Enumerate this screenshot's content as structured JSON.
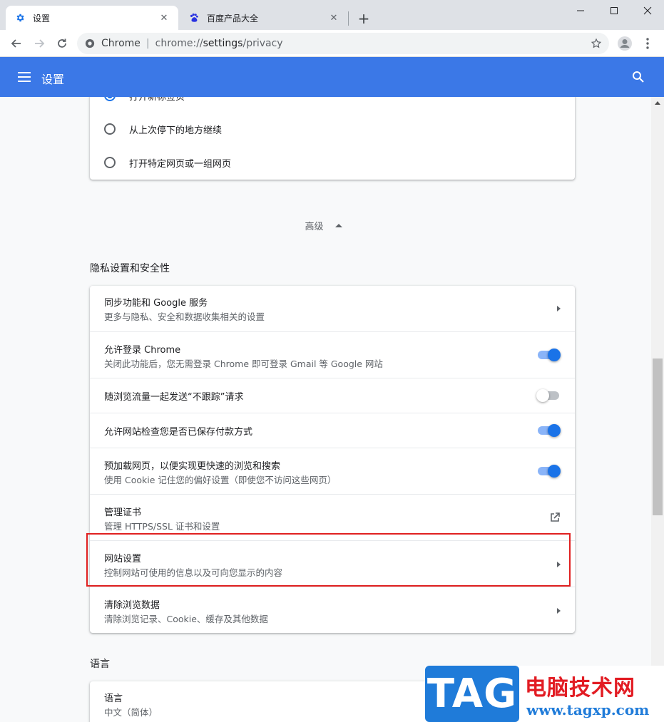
{
  "window": {
    "tabs": [
      {
        "title": "设置",
        "icon": "gear-icon",
        "active": true
      },
      {
        "title": "百度产品大全",
        "icon": "baidu-paw-icon",
        "active": false
      }
    ],
    "controls": {
      "minimize": "—",
      "maximize": "□",
      "close": "✕"
    }
  },
  "toolbar": {
    "address": {
      "chip": "Chrome",
      "divider": "|",
      "scheme": "chrome://",
      "host": "settings",
      "path": "/privacy"
    }
  },
  "appbar": {
    "title": "设置"
  },
  "startup": {
    "options": [
      {
        "label": "打开新标签页",
        "checked": true
      },
      {
        "label": "从上次停下的地方继续",
        "checked": false
      },
      {
        "label": "打开特定网页或一组网页",
        "checked": false
      }
    ]
  },
  "advanced": {
    "label": "高级"
  },
  "privacy": {
    "title": "隐私设置和安全性",
    "rows": [
      {
        "primary": "同步功能和 Google 服务",
        "secondary": "更多与隐私、安全和数据收集相关的设置",
        "action": "chevron"
      },
      {
        "primary": "允许登录 Chrome",
        "secondary": "关闭此功能后，您无需登录 Chrome 即可登录 Gmail 等 Google 网站",
        "action": "toggle",
        "on": true
      },
      {
        "primary": "随浏览流量一起发送“不跟踪”请求",
        "secondary": "",
        "action": "toggle",
        "on": false
      },
      {
        "primary": "允许网站检查您是否已保存付款方式",
        "secondary": "",
        "action": "toggle",
        "on": true
      },
      {
        "primary": "预加载网页，以便实现更快速的浏览和搜索",
        "secondary": "使用 Cookie 记住您的偏好设置（即使您不访问这些网页）",
        "action": "toggle",
        "on": true
      },
      {
        "primary": "管理证书",
        "secondary": "管理 HTTPS/SSL 证书和设置",
        "action": "external"
      },
      {
        "primary": "网站设置",
        "secondary": "控制网站可使用的信息以及可向您显示的内容",
        "action": "chevron"
      },
      {
        "primary": "清除浏览数据",
        "secondary": "清除浏览记录、Cookie、缓存及其他数据",
        "action": "chevron"
      }
    ]
  },
  "language": {
    "title": "语言",
    "row": {
      "primary": "语言",
      "secondary": "中文（简体）"
    }
  },
  "watermark": {
    "logo": "TAG",
    "name": "电脑技术网",
    "url": "www.tagxp.com"
  },
  "colors": {
    "accent": "#3b78e7",
    "toggle_on": "#1a73e8",
    "highlight": "#e02020"
  }
}
